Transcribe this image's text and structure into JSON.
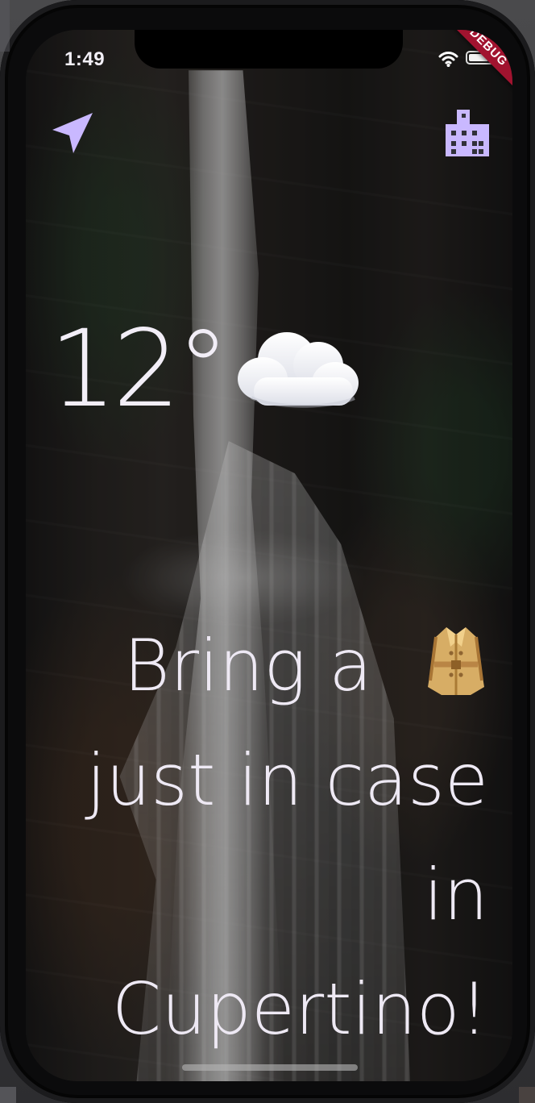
{
  "status_bar": {
    "time": "1:49",
    "debug_label": "DEBUG",
    "wifi_icon": "wifi-icon",
    "battery_icon": "battery-icon"
  },
  "toolbar": {
    "location_icon": "location-arrow-icon",
    "city_icon": "city-building-icon",
    "accent_color": "#c9b8ff"
  },
  "weather": {
    "temperature": "12°",
    "condition_icon": "cloud-icon"
  },
  "message": {
    "line1": "Bring a",
    "line1_icon": "trench-coat-icon",
    "line2": "just in case",
    "line3": "in",
    "line4": "Cupertino!"
  },
  "colors": {
    "text": "#eee9f4",
    "debug_banner": "#a1132f"
  }
}
